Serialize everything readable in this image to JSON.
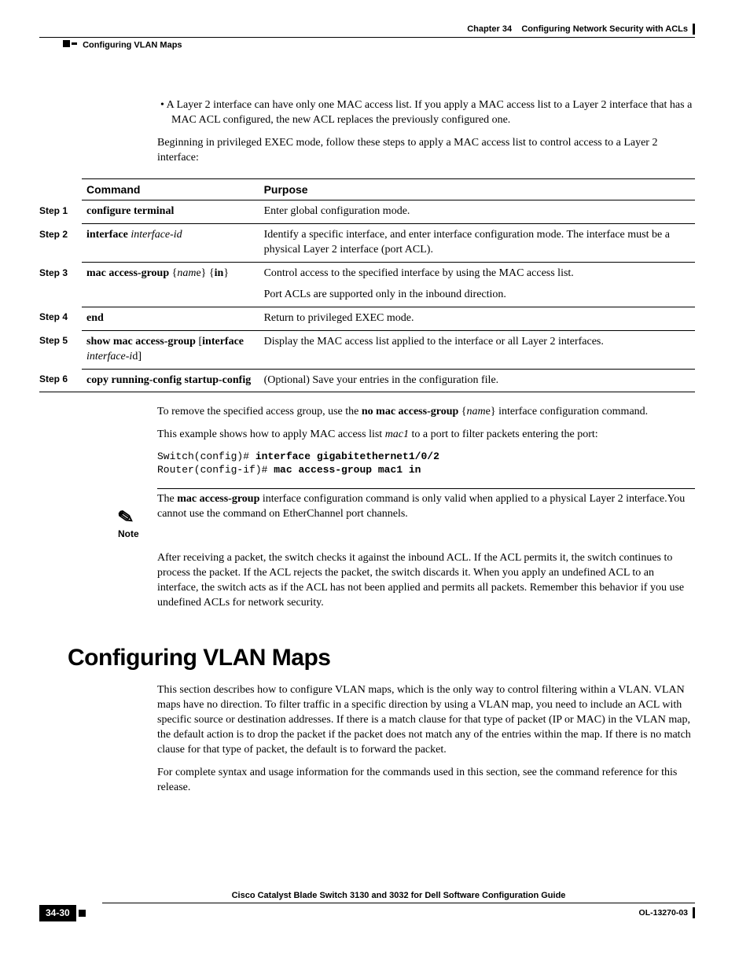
{
  "header": {
    "chapter_label": "Chapter 34",
    "chapter_title": "Configuring Network Security with ACLs",
    "section_crumb": "Configuring VLAN Maps"
  },
  "intro": {
    "bullet": "A Layer 2 interface can have only one MAC access list. If you apply a MAC access list to a Layer 2 interface that has a MAC ACL configured, the new ACL replaces the previously configured one.",
    "lead": "Beginning in privileged EXEC mode, follow these steps to apply a MAC access list to control access to a Layer 2 interface:"
  },
  "table": {
    "head_step": "",
    "head_cmd": "Command",
    "head_purpose": "Purpose",
    "rows": [
      {
        "step": "Step 1",
        "cmd_html": "<strong>configure terminal</strong>",
        "purpose": "Enter global configuration mode."
      },
      {
        "step": "Step 2",
        "cmd_html": "<strong>interface</strong> <em>interface-id</em>",
        "purpose": "Identify a specific interface, and enter interface configuration mode. The interface must be a physical Layer 2 interface (port ACL)."
      },
      {
        "step": "Step 3",
        "cmd_html": "<strong>mac access-group</strong> {<em>nam</em>e} {<strong>in</strong>}",
        "purpose": "Control access to the specified interface by using the MAC access list.",
        "purpose2": "Port ACLs are supported only in the inbound direction."
      },
      {
        "step": "Step 4",
        "cmd_html": "<strong>end</strong>",
        "purpose": "Return to privileged EXEC mode."
      },
      {
        "step": "Step 5",
        "cmd_html": "<strong>show mac access-group</strong> [<strong>interface</strong> <em>interface-i</em>d]",
        "purpose": "Display the MAC access list applied to the interface or all Layer 2 interfaces."
      },
      {
        "step": "Step 6",
        "cmd_html": "<strong>copy running-config startup-config</strong>",
        "purpose": "(Optional) Save your entries in the configuration file."
      }
    ]
  },
  "after_table": {
    "remove_html": "To remove the specified access group, use the <strong>no mac access-group</strong> {<em>nam</em>e} interface configuration command.",
    "example_html": "This example shows how to apply MAC access list <em>mac1</em> to a port to filter packets entering the port:",
    "code_line1_p": "Switch(config)# ",
    "code_line1_b": "interface gigabitethernet1/0/2",
    "code_line2_p": "Router(config-if)# ",
    "code_line2_b": "mac access-group mac1 in"
  },
  "note": {
    "label": "Note",
    "body_html": "The <strong>mac access-group</strong> interface configuration command is only valid when applied to a physical Layer 2 interface.You cannot use the command on EtherChannel port channels."
  },
  "after_note": "After receiving a packet, the switch checks it against the inbound ACL. If the ACL permits it, the switch continues to process the packet. If the ACL rejects the packet, the switch discards it. When you apply an undefined ACL to an interface, the switch acts as if the ACL has not been applied and permits all packets. Remember this behavior if you use undefined ACLs for network security.",
  "section": {
    "title": "Configuring VLAN Maps",
    "p1": "This section describes how to configure VLAN maps, which is the only way to control filtering within a VLAN. VLAN maps have no direction. To filter traffic in a specific direction by using a VLAN map, you need to include an ACL with specific source or destination addresses. If there is a match clause for that type of packet (IP or MAC) in the VLAN map, the default action is to drop the packet if the packet does not match any of the entries within the map. If there is no match clause for that type of packet, the default is to forward the packet.",
    "p2": "For complete syntax and usage information for the commands used in this section, see the command reference for this release."
  },
  "footer": {
    "guide": "Cisco Catalyst Blade Switch 3130 and 3032 for Dell Software Configuration Guide",
    "page": "34-30",
    "doc": "OL-13270-03"
  }
}
